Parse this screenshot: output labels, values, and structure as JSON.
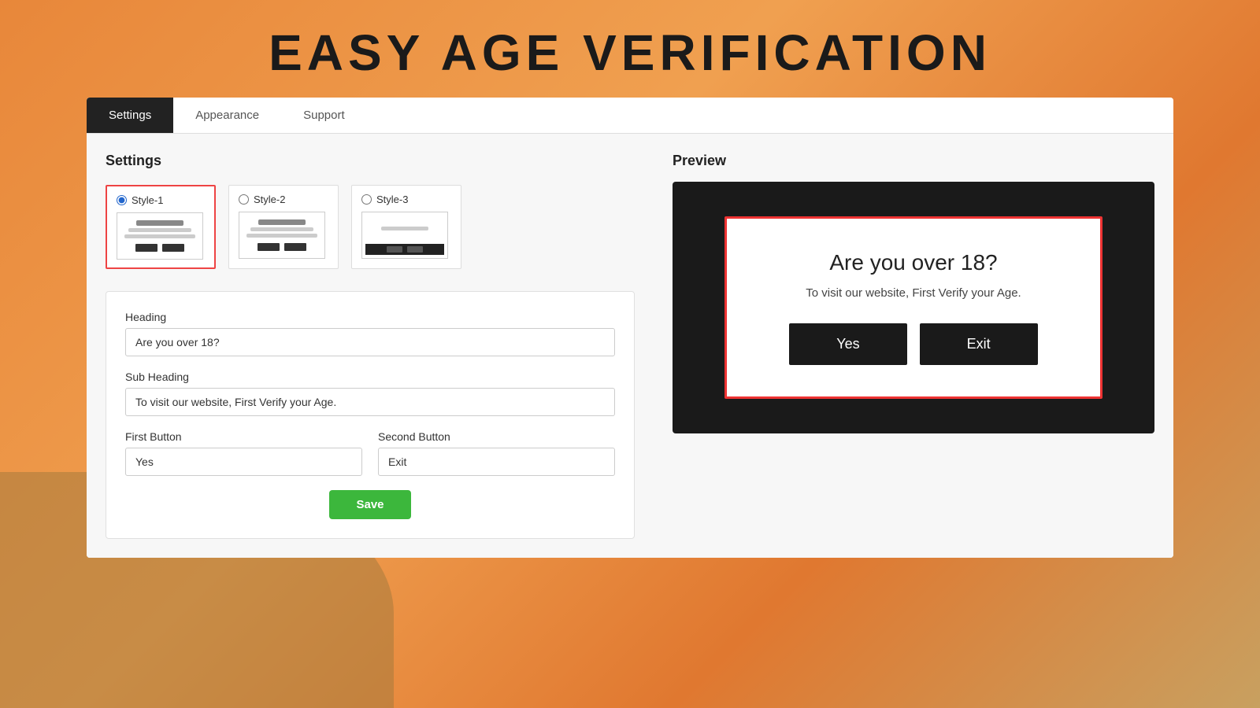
{
  "page": {
    "title": "EASY AGE VERIFICATION"
  },
  "tabs": [
    {
      "id": "settings",
      "label": "Settings",
      "active": true
    },
    {
      "id": "appearance",
      "label": "Appearance",
      "active": false
    },
    {
      "id": "support",
      "label": "Support",
      "active": false
    }
  ],
  "settings": {
    "section_title": "Settings",
    "styles": [
      {
        "id": "style1",
        "label": "Style-1",
        "selected": true
      },
      {
        "id": "style2",
        "label": "Style-2",
        "selected": false
      },
      {
        "id": "style3",
        "label": "Style-3",
        "selected": false
      }
    ],
    "heading_label": "Heading",
    "heading_value": "Are you over 18?",
    "heading_placeholder": "Are you over 18?",
    "subheading_label": "Sub Heading",
    "subheading_value": "To visit our website, First Verify your Age.",
    "subheading_placeholder": "To visit our website, First Verify your Age.",
    "first_button_label": "First Button",
    "first_button_value": "Yes",
    "second_button_label": "Second Button",
    "second_button_value": "Exit",
    "save_label": "Save"
  },
  "preview": {
    "title": "Preview",
    "modal": {
      "heading": "Are you over 18?",
      "subheading": "To visit our website, First Verify your Age.",
      "yes_button": "Yes",
      "exit_button": "Exit"
    }
  }
}
